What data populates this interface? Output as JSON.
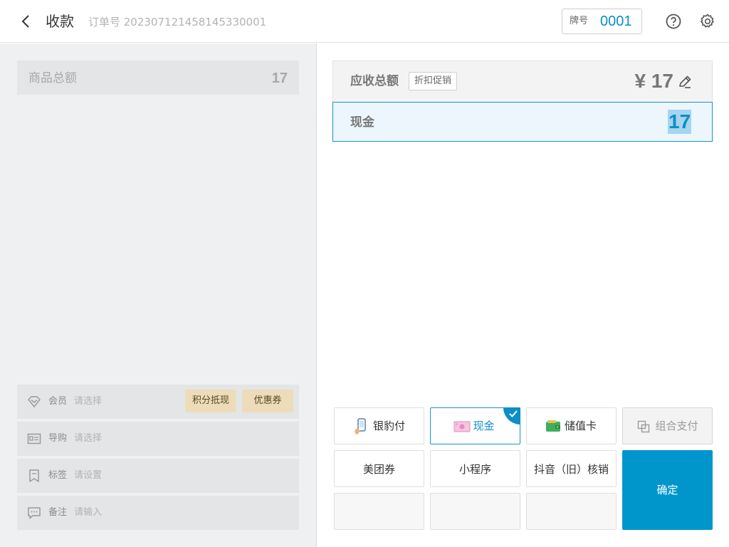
{
  "header": {
    "title": "收款",
    "order": "订单号 20230712145814533000​1",
    "tag_label": "牌号",
    "tag_value": "0001"
  },
  "left": {
    "goods_label": "商品总额",
    "goods_value": "17",
    "member": {
      "label": "会员",
      "placeholder": "请选择",
      "points_btn": "积分抵现",
      "coupon_btn": "优惠券"
    },
    "guide": {
      "label": "导购",
      "placeholder": "请选择"
    },
    "tag": {
      "label": "标签",
      "placeholder": "请设置"
    },
    "note": {
      "label": "备注",
      "placeholder": "请输入"
    }
  },
  "right": {
    "due_label": "应收总额",
    "promo_btn": "折扣促销",
    "due_amount": "¥ 17",
    "cash_label": "现金",
    "cash_value": "17"
  },
  "payments": {
    "yinbaofu": "银豹付",
    "cash": "现金",
    "stored_card": "储值卡",
    "combo": "组合支付",
    "meituan": "美团券",
    "miniapp": "小程序",
    "douyin": "抖音（旧）核销",
    "confirm": "确定"
  },
  "colors": {
    "accent": "#0096cc",
    "chip": "#ecdcb9"
  },
  "icons": {
    "back": "chevron-left-icon",
    "help": "help-circle-icon",
    "settings": "gear-icon",
    "edit": "pencil-icon"
  }
}
